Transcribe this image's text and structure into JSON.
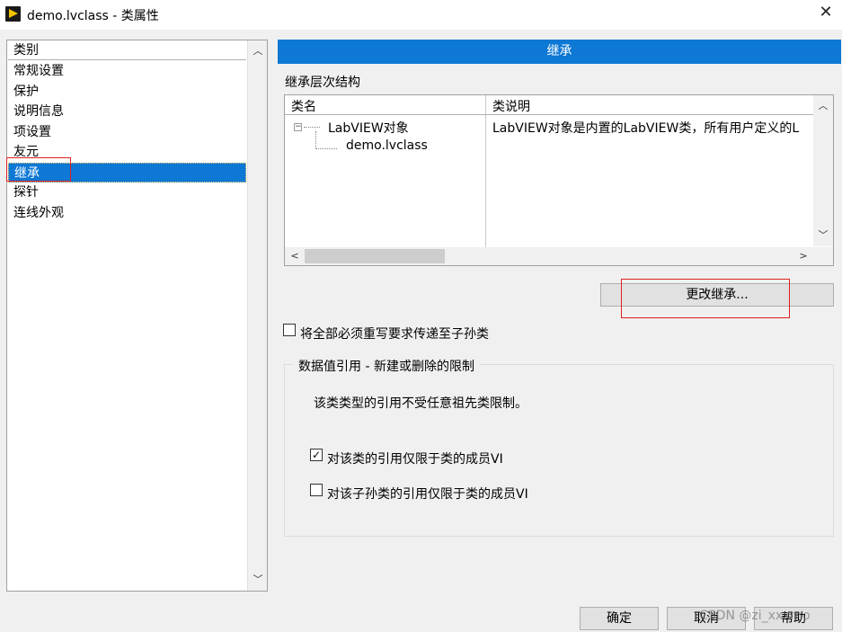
{
  "window": {
    "title": "demo.lvclass  - 类属性",
    "close_glyph": "✕"
  },
  "sidebar": {
    "header": "类别",
    "items": [
      {
        "label": "常规设置"
      },
      {
        "label": "保护"
      },
      {
        "label": "说明信息"
      },
      {
        "label": "项设置"
      },
      {
        "label": "友元"
      },
      {
        "label": "继承"
      },
      {
        "label": "探针"
      },
      {
        "label": "连线外观"
      }
    ],
    "selected": "继承"
  },
  "main": {
    "section_title": "继承",
    "hierarchy_label": "继承层次结构",
    "table": {
      "columns": [
        "类名",
        "类说明"
      ],
      "rows": [
        {
          "name": "LabVIEW对象",
          "description": "LabVIEW对象是内置的LabVIEW类，所有用户定义的L"
        },
        {
          "name": "demo.lvclass",
          "description": ""
        }
      ]
    },
    "change_inheritance_button": "更改继承...",
    "propagate_checkbox": {
      "label": "将全部必须重写要求传递至子孙类",
      "checked": false
    },
    "group": {
      "title": "数据值引用 - 新建或删除的限制",
      "note": "该类类型的引用不受任意祖先类限制。",
      "checkbox1": {
        "label": "对该类的引用仅限于类的成员VI",
        "checked": true
      },
      "checkbox2": {
        "label": "对该子孙类的引用仅限于类的成员VI",
        "checked": false
      }
    }
  },
  "footer": {
    "ok": "确定",
    "cancel": "取消",
    "help": "帮助",
    "watermark": "CSDN @zi_xxxmo"
  },
  "colors": {
    "accent": "#0e78d5",
    "highlight_box": "#e02020"
  }
}
